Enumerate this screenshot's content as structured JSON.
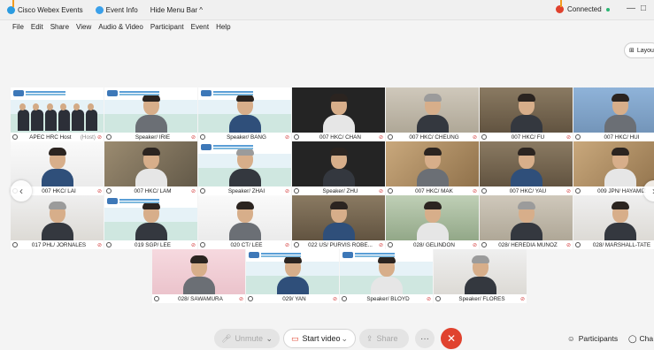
{
  "topbar": {
    "app_name": "Cisco Webex Events",
    "event_info": "Event Info",
    "hide_menu": "Hide Menu Bar ^",
    "status": "Connected",
    "minimize": "—",
    "restore": "□"
  },
  "menubar": [
    "File",
    "Edit",
    "Share",
    "View",
    "Audio & Video",
    "Participant",
    "Event",
    "Help"
  ],
  "layout_label": "Layou",
  "colors": {
    "accent_red": "#e0422e",
    "status_green": "#2bb673",
    "brand_blue": "#2a9be0",
    "mute_red": "#d43a3a"
  },
  "tiles": [
    {
      "name": "APEC HRC Host",
      "extra": "(Host)",
      "kind": "host",
      "bg": "bg-slide"
    },
    {
      "name": "Speaker/ IRIE",
      "kind": "person",
      "bg": "bg-slide"
    },
    {
      "name": "Speaker/ BANG",
      "kind": "person",
      "bg": "bg-slide"
    },
    {
      "name": "007 HKC/ CHAN",
      "kind": "person",
      "bg": "bg-dark"
    },
    {
      "name": "007 HKC/ CHEUNG",
      "kind": "person",
      "bg": "bg-room"
    },
    {
      "name": "007 HKC/ FU",
      "kind": "person",
      "bg": "bg-shelf"
    },
    {
      "name": "007 HKC/ HUI",
      "kind": "person",
      "bg": "bg-blue"
    },
    {
      "name": "007 HKC/ LAI",
      "kind": "person",
      "bg": "bg-white"
    },
    {
      "name": "007 HKC/ LAM",
      "kind": "person",
      "bg": "bg-office"
    },
    {
      "name": "Speaker/ ZHAI",
      "kind": "person",
      "bg": "bg-slide"
    },
    {
      "name": "Speaker/ ZHU",
      "kind": "person",
      "bg": "bg-dark"
    },
    {
      "name": "007 HKC/ MAK",
      "kind": "person",
      "bg": "bg-warm"
    },
    {
      "name": "007 HKC/ YAU",
      "kind": "person",
      "bg": "bg-shelf"
    },
    {
      "name": "009 JPN/ HAYAMIZ",
      "kind": "person",
      "bg": "bg-warm"
    },
    {
      "name": "017 PHL/ JORNALES",
      "kind": "person",
      "bg": "bg-light"
    },
    {
      "name": "019 SGP/ LEE",
      "kind": "person",
      "bg": "bg-slide"
    },
    {
      "name": "020 CT/ LEE",
      "kind": "person",
      "bg": "bg-white"
    },
    {
      "name": "022 US/ PURVIS ROBE...",
      "kind": "person",
      "bg": "bg-shelf"
    },
    {
      "name": "028/ GELINDON",
      "kind": "person",
      "bg": "bg-green"
    },
    {
      "name": "028/ HEREDIA MUNOZ",
      "kind": "person",
      "bg": "bg-room"
    },
    {
      "name": "028/ MARSHALL-TATE",
      "kind": "person",
      "bg": "bg-light"
    },
    {
      "name": "028/ SAWAMURA",
      "kind": "person",
      "bg": "bg-pink"
    },
    {
      "name": "029/ YAN",
      "kind": "person",
      "bg": "bg-slide"
    },
    {
      "name": "Speaker/ BLOYD",
      "kind": "person",
      "bg": "bg-slide"
    },
    {
      "name": "Speaker/ FLORES",
      "kind": "person",
      "bg": "bg-light"
    }
  ],
  "controls": {
    "unmute": "Unmute",
    "start_video": "Start video",
    "share": "Share",
    "more": "···",
    "end": "✕",
    "participants": "Participants",
    "chat": "Cha"
  },
  "icons": [
    "webex-logo-icon",
    "info-icon",
    "mic-icon",
    "video-icon",
    "share-icon",
    "participants-icon",
    "chat-icon",
    "layout-icon",
    "chevron-left-icon",
    "chevron-right-icon"
  ]
}
